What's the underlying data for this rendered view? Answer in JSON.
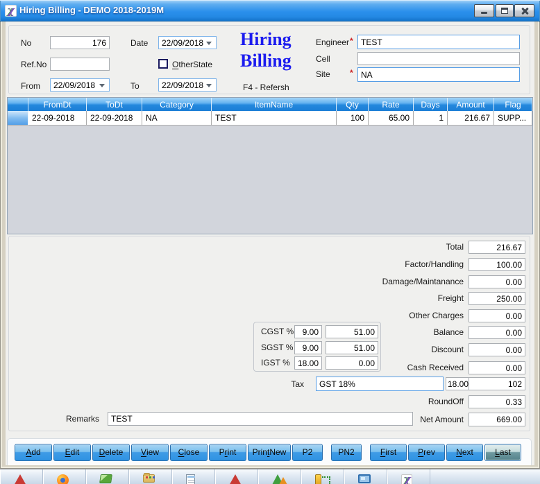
{
  "window": {
    "title": "Hiring Billing - DEMO 2018-2019M"
  },
  "header_form": {
    "no": {
      "label": "No",
      "value": "176"
    },
    "date": {
      "label": "Date",
      "value": "22/09/2018"
    },
    "ref_no": {
      "label": "Ref.No",
      "value": ""
    },
    "other_state": {
      "label": "OtherState",
      "key": "O",
      "checked": false
    },
    "from": {
      "label": "From",
      "value": "22/09/2018"
    },
    "to": {
      "label": "To",
      "value": "22/09/2018"
    },
    "app_name_line1": "Hiring",
    "app_name_line2": "Billing",
    "refresh_hint": "F4 - Refersh",
    "engineer": {
      "label": "Engineer",
      "required_mark": "*",
      "value": "TEST"
    },
    "cell": {
      "label": "Cell",
      "value": ""
    },
    "site": {
      "label": "Site",
      "required_mark": "*",
      "value": "NA"
    }
  },
  "grid": {
    "columns": [
      "FromDt",
      "ToDt",
      "Category",
      "ItemName",
      "Qty",
      "Rate",
      "Days",
      "Amount",
      "Flag"
    ],
    "rows": [
      [
        "22-09-2018",
        "22-09-2018",
        "NA",
        "TEST",
        "100",
        "65.00",
        "1",
        "216.67",
        "SUPP..."
      ]
    ]
  },
  "charges": {
    "total": {
      "label": "Total",
      "value": "216.67"
    },
    "factor_handling": {
      "label": "Factor/Handling",
      "value": "100.00"
    },
    "damage_maintanance": {
      "label": "Damage/Maintanance",
      "value": "0.00"
    },
    "freight": {
      "label": "Freight",
      "value": "250.00"
    },
    "other_charges": {
      "label": "Other Charges",
      "value": "0.00"
    },
    "balance": {
      "label": "Balance",
      "value": "0.00"
    },
    "discount": {
      "label": "Discount",
      "value": "0.00"
    },
    "cash_received": {
      "label": "Cash Received",
      "value": "0.00"
    },
    "round_off": {
      "label": "RoundOff",
      "value": "0.33"
    },
    "net_amount": {
      "label": "Net Amount",
      "value": "669.00"
    }
  },
  "gst": {
    "cgst": {
      "label": "CGST %",
      "rate": "9.00",
      "amount": "51.00"
    },
    "sgst": {
      "label": "SGST %",
      "rate": "9.00",
      "amount": "51.00"
    },
    "igst": {
      "label": "IGST %",
      "rate": "18.00",
      "amount": "0.00"
    }
  },
  "tax": {
    "label": "Tax",
    "selected": "GST 18%",
    "rate": "18.00",
    "amount": "102"
  },
  "remarks": {
    "label": "Remarks",
    "value": "TEST"
  },
  "action_buttons": [
    {
      "label": "Add",
      "key": "A"
    },
    {
      "label": "Edit",
      "key": "E"
    },
    {
      "label": "Delete",
      "key": "D"
    },
    {
      "label": "View",
      "key": "V"
    },
    {
      "label": "Close",
      "key": "C"
    },
    {
      "label": "Print",
      "key": "r"
    },
    {
      "label": "Print New",
      "key": "t"
    },
    {
      "label": "P2"
    },
    {
      "label": "PN2",
      "gap_before": true
    },
    {
      "label": "First",
      "key": "F",
      "gap_before": true
    },
    {
      "label": "Prev",
      "key": "P"
    },
    {
      "label": "Next",
      "key": "N"
    },
    {
      "label": "Last",
      "key": "L",
      "focused": true
    }
  ],
  "taskbar": {
    "icons": [
      "red-triangle",
      "firefox",
      "green-share",
      "folder-files",
      "notepad",
      "red-triangle-2",
      "chart",
      "measure",
      "display",
      "chi-app"
    ]
  },
  "colors": {
    "accent_blue": "#2b90ec",
    "grid_header": "#1b7ed6",
    "app_name_blue": "#1b1bef",
    "required_red": "#cc2222"
  }
}
